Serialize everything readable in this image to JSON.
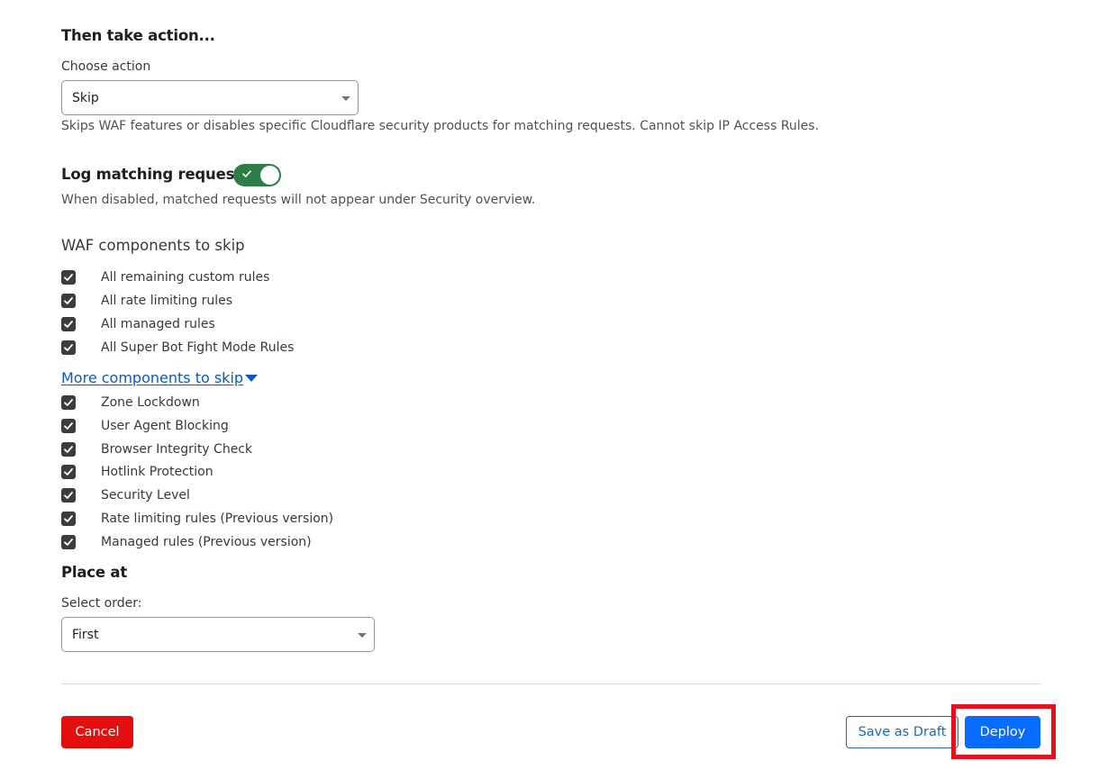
{
  "action_section": {
    "title": "Then take action...",
    "choose_label": "Choose action",
    "selected_action": "Skip",
    "help": "Skips WAF features or disables specific Cloudflare security products for matching requests. Cannot skip IP Access Rules."
  },
  "log_section": {
    "title": "Log matching requests",
    "toggle_on": true,
    "help": "When disabled, matched requests will not appear under Security overview."
  },
  "waf_section": {
    "heading": "WAF components to skip",
    "items": [
      {
        "label": "All remaining custom rules",
        "checked": true
      },
      {
        "label": "All rate limiting rules",
        "checked": true
      },
      {
        "label": "All managed rules",
        "checked": true
      },
      {
        "label": "All Super Bot Fight Mode Rules",
        "checked": true
      }
    ],
    "more_link": "More components to skip",
    "more_items": [
      {
        "label": "Zone Lockdown",
        "checked": true
      },
      {
        "label": "User Agent Blocking",
        "checked": true
      },
      {
        "label": "Browser Integrity Check",
        "checked": true
      },
      {
        "label": "Hotlink Protection",
        "checked": true
      },
      {
        "label": "Security Level",
        "checked": true
      },
      {
        "label": "Rate limiting rules (Previous version)",
        "checked": true
      },
      {
        "label": "Managed rules (Previous version)",
        "checked": true
      }
    ]
  },
  "place_section": {
    "title": "Place at",
    "order_label": "Select order:",
    "selected_order": "First"
  },
  "footer": {
    "cancel_label": "Cancel",
    "draft_label": "Save as Draft",
    "deploy_label": "Deploy"
  },
  "colors": {
    "toggle_on": "#2e7d46",
    "link": "#0b57d0",
    "cancel": "#e30f0f",
    "deploy": "#0a6cff",
    "highlight": "#e8101c"
  }
}
